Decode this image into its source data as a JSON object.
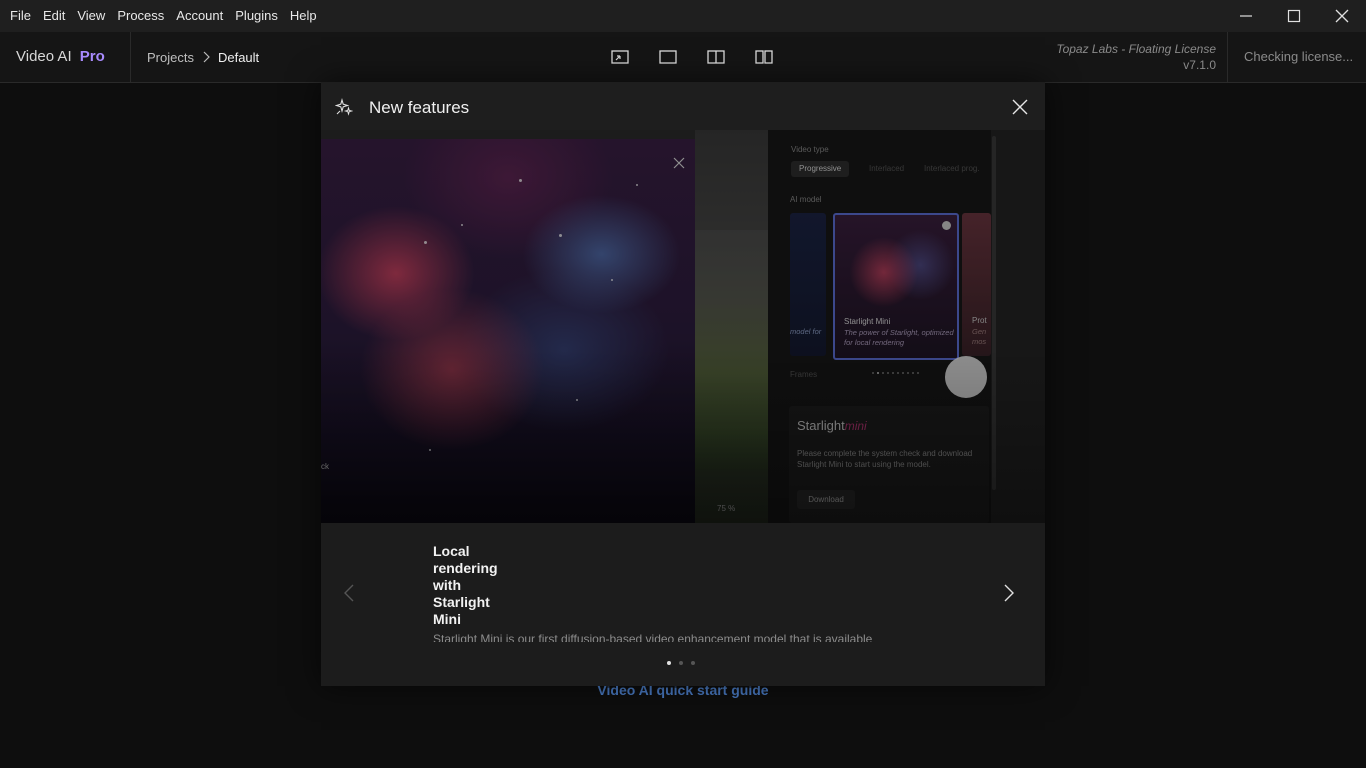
{
  "menu": {
    "items": [
      "File",
      "Edit",
      "View",
      "Process",
      "Account",
      "Plugins",
      "Help"
    ]
  },
  "window_controls": [
    "minimize-icon",
    "maximize-icon",
    "close-icon"
  ],
  "header": {
    "brand_name": "Video AI",
    "brand_edition": "Pro",
    "breadcrumb": {
      "root": "Projects",
      "current": "Default"
    },
    "view_modes": [
      "crop-view-icon",
      "single-view-icon",
      "split-view-icon",
      "side-by-side-view-icon"
    ],
    "license_name": "Topaz Labs - Floating License",
    "version": "v7.1.0",
    "license_status": "Checking license..."
  },
  "background": {
    "quick_start_link": "Video AI quick start guide"
  },
  "dialog": {
    "title": "New features",
    "title_icon": "sparkles-icon",
    "media_preview": {
      "zoom_level": "75 %",
      "video_type_label": "Video type",
      "video_type_options": [
        "Progressive",
        "Interlaced",
        "Interlaced prog."
      ],
      "video_type_selected": "Progressive",
      "ai_model_label": "AI model",
      "card_left_desc": "model for",
      "card_title": "Starlight Mini",
      "card_desc": "The power of Starlight, optimized for local rendering",
      "card_right_title": "Prot",
      "card_right_desc": "Gen mos",
      "filter_label": "Frames",
      "model_name": "Starlight",
      "model_suffix": "mini",
      "model_desc": "Please complete the system check and download Starlight Mini to start using the model.",
      "download_label": "Download",
      "overlay_caption": "ck"
    },
    "slide": {
      "title": "Local rendering with Starlight Mini",
      "description": "Starlight Mini is our first diffusion-based video enhancement model that is available",
      "slide_count": 3,
      "active_index": 0
    }
  },
  "colors": {
    "accent_pro": "#a98bff",
    "link_blue": "#4a7cc6",
    "card_border": "#5d6fd8",
    "starlight_mini_pink": "#c0397a"
  }
}
